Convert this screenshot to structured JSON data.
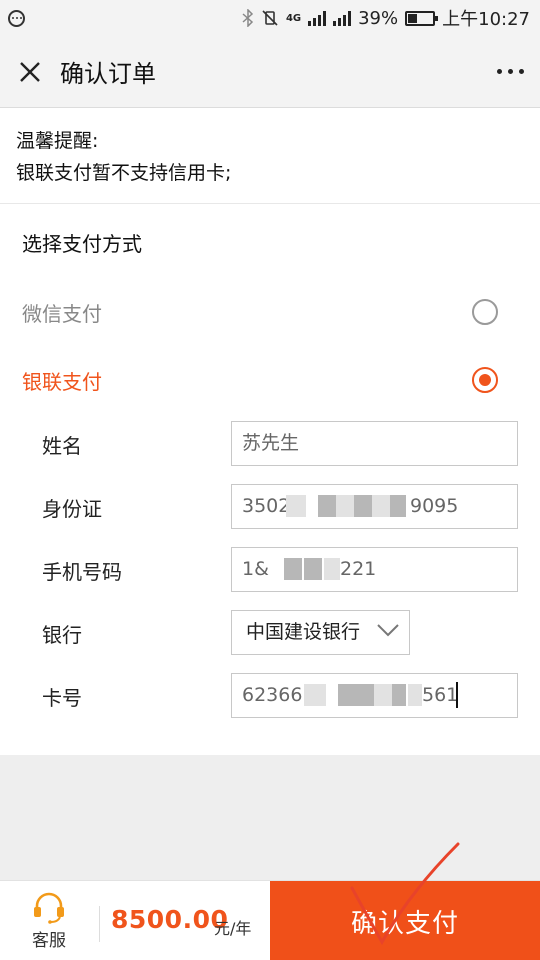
{
  "status_bar": {
    "battery_percent": "39%",
    "time": "上午10:27",
    "network": "4G",
    "battery_level": 0.39
  },
  "header": {
    "title": "确认订单"
  },
  "notice": {
    "line1": "温馨提醒:",
    "line2": "银联支付暂不支持信用卡;"
  },
  "payment": {
    "section_title": "选择支付方式",
    "options": [
      {
        "label": "微信支付",
        "selected": false
      },
      {
        "label": "银联支付",
        "selected": true
      }
    ]
  },
  "form": {
    "name": {
      "label": "姓名",
      "value": "苏先生"
    },
    "id_card": {
      "label": "身份证",
      "prefix": "3502",
      "suffix": "9095"
    },
    "phone": {
      "label": "手机号码",
      "prefix": "1&",
      "suffix": "221"
    },
    "bank": {
      "label": "银行",
      "value": "中国建设银行"
    },
    "card": {
      "label": "卡号",
      "prefix": "62366",
      "suffix": "561"
    }
  },
  "bottom_bar": {
    "service_label": "客服",
    "price": "8500.00",
    "unit": "元/年",
    "confirm_label": "确认支付"
  },
  "colors": {
    "accent": "#f0541c",
    "status_bar_bg": "#f3f3f3",
    "gray_area": "#eeeeee"
  }
}
